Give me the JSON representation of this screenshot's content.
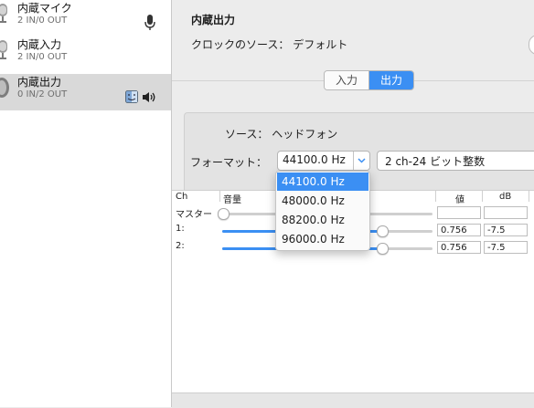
{
  "sidebar": {
    "devices": [
      {
        "name": "内蔵マイク",
        "io": "2 IN/0 OUT",
        "selected": false,
        "icon": "microphone-icon"
      },
      {
        "name": "内蔵入力",
        "io": "2 IN/0 OUT",
        "selected": false,
        "icon": ""
      },
      {
        "name": "内蔵出力",
        "io": "0 IN/2 OUT",
        "selected": true,
        "icon": "speaker-icon"
      }
    ]
  },
  "device": {
    "title": "内蔵出力",
    "clock_source": "クロックのソース：  デフォルト"
  },
  "tabs": {
    "input": "入力",
    "output": "出力",
    "active": "output"
  },
  "format": {
    "source_label": "ソース：  ヘッドフォン",
    "format_label": "フォーマット：",
    "sample_rate": "44100.0 Hz",
    "bit_format": "2 ch-24 ビット整数"
  },
  "table": {
    "headers": {
      "ch": "Ch",
      "volume": "音量",
      "value": "値",
      "db": "dB"
    },
    "rows": [
      {
        "label": "マスター",
        "level": 0.0,
        "value": "",
        "db": ""
      },
      {
        "label": "1:",
        "level": 0.756,
        "value": "0.756",
        "db": "-7.5"
      },
      {
        "label": "2:",
        "level": 0.756,
        "value": "0.756",
        "db": "-7.5"
      }
    ]
  },
  "dropdown": {
    "options": [
      "44100.0 Hz",
      "48000.0 Hz",
      "88200.0 Hz",
      "96000.0 Hz"
    ],
    "highlighted": "44100.0 Hz"
  },
  "colors": {
    "accent": "#3b8ff3",
    "sidebar_selected": "#d9d9d9"
  }
}
